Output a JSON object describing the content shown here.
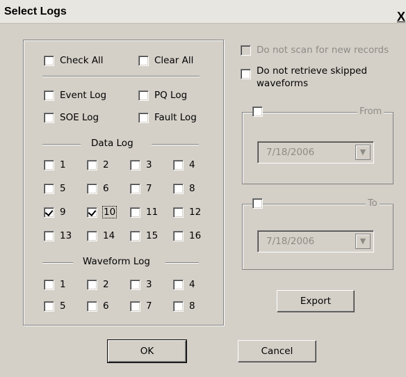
{
  "window": {
    "title": "Select Logs",
    "close_label": "X"
  },
  "general": {
    "check_all": "Check All",
    "clear_all": "Clear All"
  },
  "logs": {
    "event": "Event Log",
    "pq": "PQ Log",
    "soe": "SOE Log",
    "fault": "Fault Log"
  },
  "data_log": {
    "heading": "Data Log",
    "items": [
      {
        "label": "1",
        "checked": false
      },
      {
        "label": "2",
        "checked": false
      },
      {
        "label": "3",
        "checked": false
      },
      {
        "label": "4",
        "checked": false
      },
      {
        "label": "5",
        "checked": false
      },
      {
        "label": "6",
        "checked": false
      },
      {
        "label": "7",
        "checked": false
      },
      {
        "label": "8",
        "checked": false
      },
      {
        "label": "9",
        "checked": true
      },
      {
        "label": "10",
        "checked": true
      },
      {
        "label": "11",
        "checked": false
      },
      {
        "label": "12",
        "checked": false
      },
      {
        "label": "13",
        "checked": false
      },
      {
        "label": "14",
        "checked": false
      },
      {
        "label": "15",
        "checked": false
      },
      {
        "label": "16",
        "checked": false
      }
    ]
  },
  "waveform_log": {
    "heading": "Waveform Log",
    "items": [
      {
        "label": "1",
        "checked": false
      },
      {
        "label": "2",
        "checked": false
      },
      {
        "label": "3",
        "checked": false
      },
      {
        "label": "4",
        "checked": false
      },
      {
        "label": "5",
        "checked": false
      },
      {
        "label": "6",
        "checked": false
      },
      {
        "label": "7",
        "checked": false
      },
      {
        "label": "8",
        "checked": false
      }
    ]
  },
  "options": {
    "no_scan": "Do not scan for new records",
    "no_retrieve_line1": "Do not retrieve skipped",
    "no_retrieve_line2": "waveforms"
  },
  "range": {
    "from_label": "From",
    "from_date": "7/18/2006",
    "to_label": "To",
    "to_date": "7/18/2006"
  },
  "buttons": {
    "export": "Export",
    "ok": "OK",
    "cancel": "Cancel"
  }
}
